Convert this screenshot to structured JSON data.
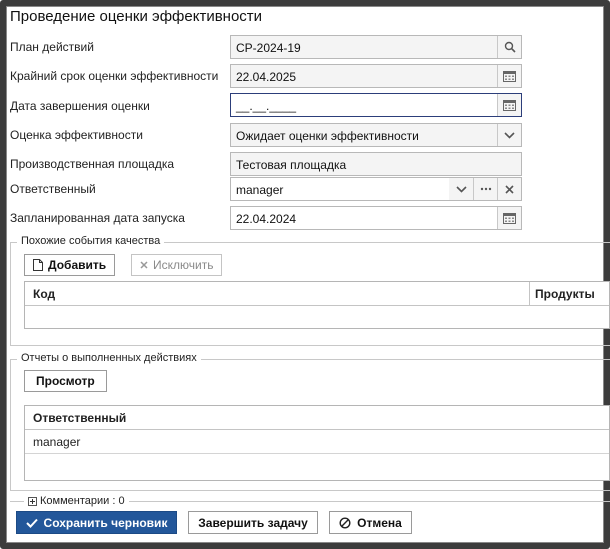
{
  "window": {
    "title": "Проведение оценки эффективности"
  },
  "form": {
    "action_plan": {
      "label": "План действий",
      "value": "CP-2024-19"
    },
    "deadline": {
      "label": "Крайний срок оценки эффективности",
      "value": "22.04.2025"
    },
    "completion_date": {
      "label": "Дата завершения оценки",
      "value": "__.__.____"
    },
    "effectiveness": {
      "label": "Оценка эффективности",
      "value": "Ожидает оценки эффективности"
    },
    "site": {
      "label": "Производственная площадка",
      "value": "Тестовая площадка"
    },
    "responsible": {
      "label": "Ответственный",
      "value": "manager"
    },
    "planned_start": {
      "label": "Запланированная дата запуска",
      "value": "22.04.2024"
    }
  },
  "quality_events": {
    "legend": "Похожие события качества",
    "add_label": "Добавить",
    "exclude_label": "Исключить",
    "columns": [
      "Код",
      "Продукты"
    ]
  },
  "reports": {
    "legend": "Отчеты о выполненных действиях",
    "view_label": "Просмотр",
    "column": "Ответственный",
    "rows": [
      "manager"
    ]
  },
  "comments": {
    "label": "Комментарии : 0"
  },
  "footer": {
    "save_draft": "Сохранить черновик",
    "complete_task": "Завершить задачу",
    "cancel": "Отмена"
  },
  "colors": {
    "primary": "#23579a",
    "active_border": "#2c3e7a",
    "field_bg": "#f4f4f4"
  }
}
